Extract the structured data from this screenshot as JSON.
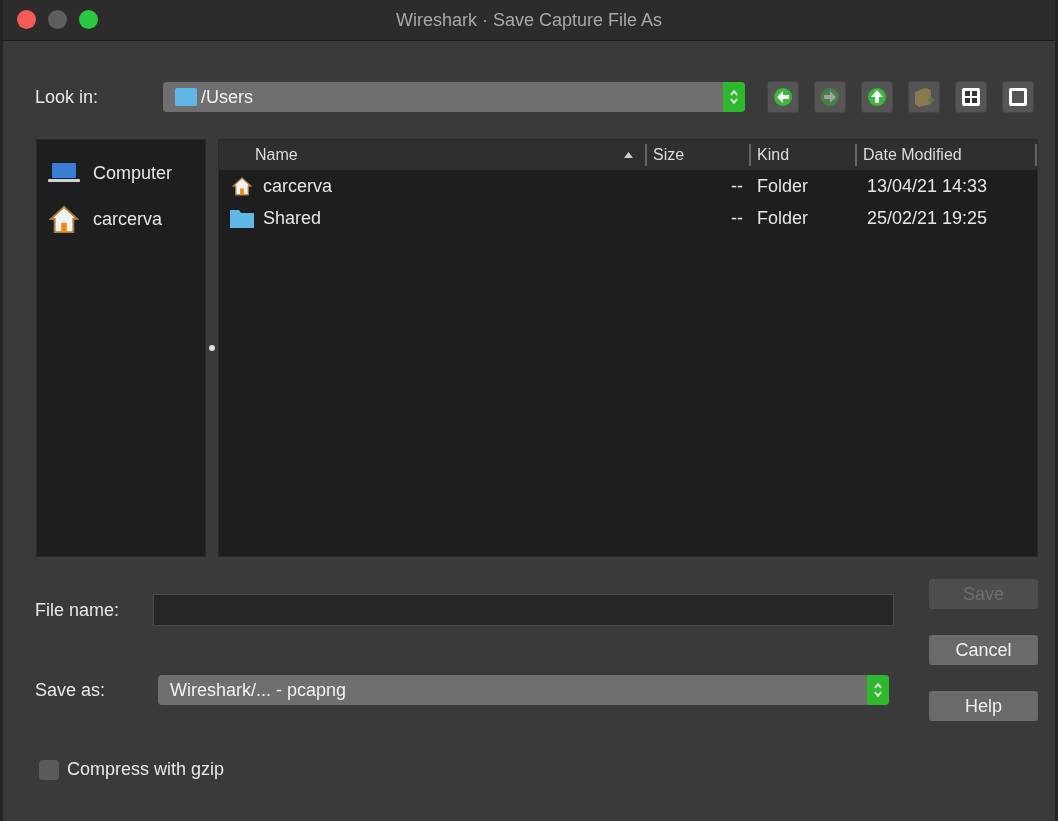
{
  "window": {
    "title": "Wireshark · Save Capture File As"
  },
  "look_in": {
    "label": "Look in:",
    "path": "/Users"
  },
  "toolbar": [
    {
      "kind": "back",
      "disabled": false
    },
    {
      "kind": "forward",
      "disabled": true
    },
    {
      "kind": "up",
      "disabled": false
    },
    {
      "kind": "new-folder",
      "disabled": true
    },
    {
      "kind": "grid-view",
      "disabled": false
    },
    {
      "kind": "detail-view",
      "disabled": false
    }
  ],
  "sidebar": {
    "items": [
      {
        "label": "Computer",
        "kind": "computer"
      },
      {
        "label": "carcerva",
        "kind": "home"
      }
    ]
  },
  "table": {
    "columns": [
      {
        "label": "Name",
        "sorted": true
      },
      {
        "label": "Size",
        "sorted": false
      },
      {
        "label": "Kind",
        "sorted": false
      },
      {
        "label": "Date Modified",
        "sorted": false
      }
    ],
    "rows": [
      {
        "kind": "home",
        "name": "carcerva",
        "size": "--",
        "type": "Folder",
        "modified": "13/04/21 14:33"
      },
      {
        "kind": "folder",
        "name": "Shared",
        "size": "--",
        "type": "Folder",
        "modified": "25/02/21 19:25"
      }
    ]
  },
  "file_name": {
    "label": "File name:"
  },
  "save_as": {
    "label": "Save as:",
    "value": "Wireshark/... - pcapng"
  },
  "compress": {
    "label": "Compress with gzip",
    "checked": false
  },
  "buttons": [
    {
      "label": "Save",
      "disabled": true
    },
    {
      "label": "Cancel",
      "disabled": false
    },
    {
      "label": "Help",
      "disabled": false
    }
  ]
}
